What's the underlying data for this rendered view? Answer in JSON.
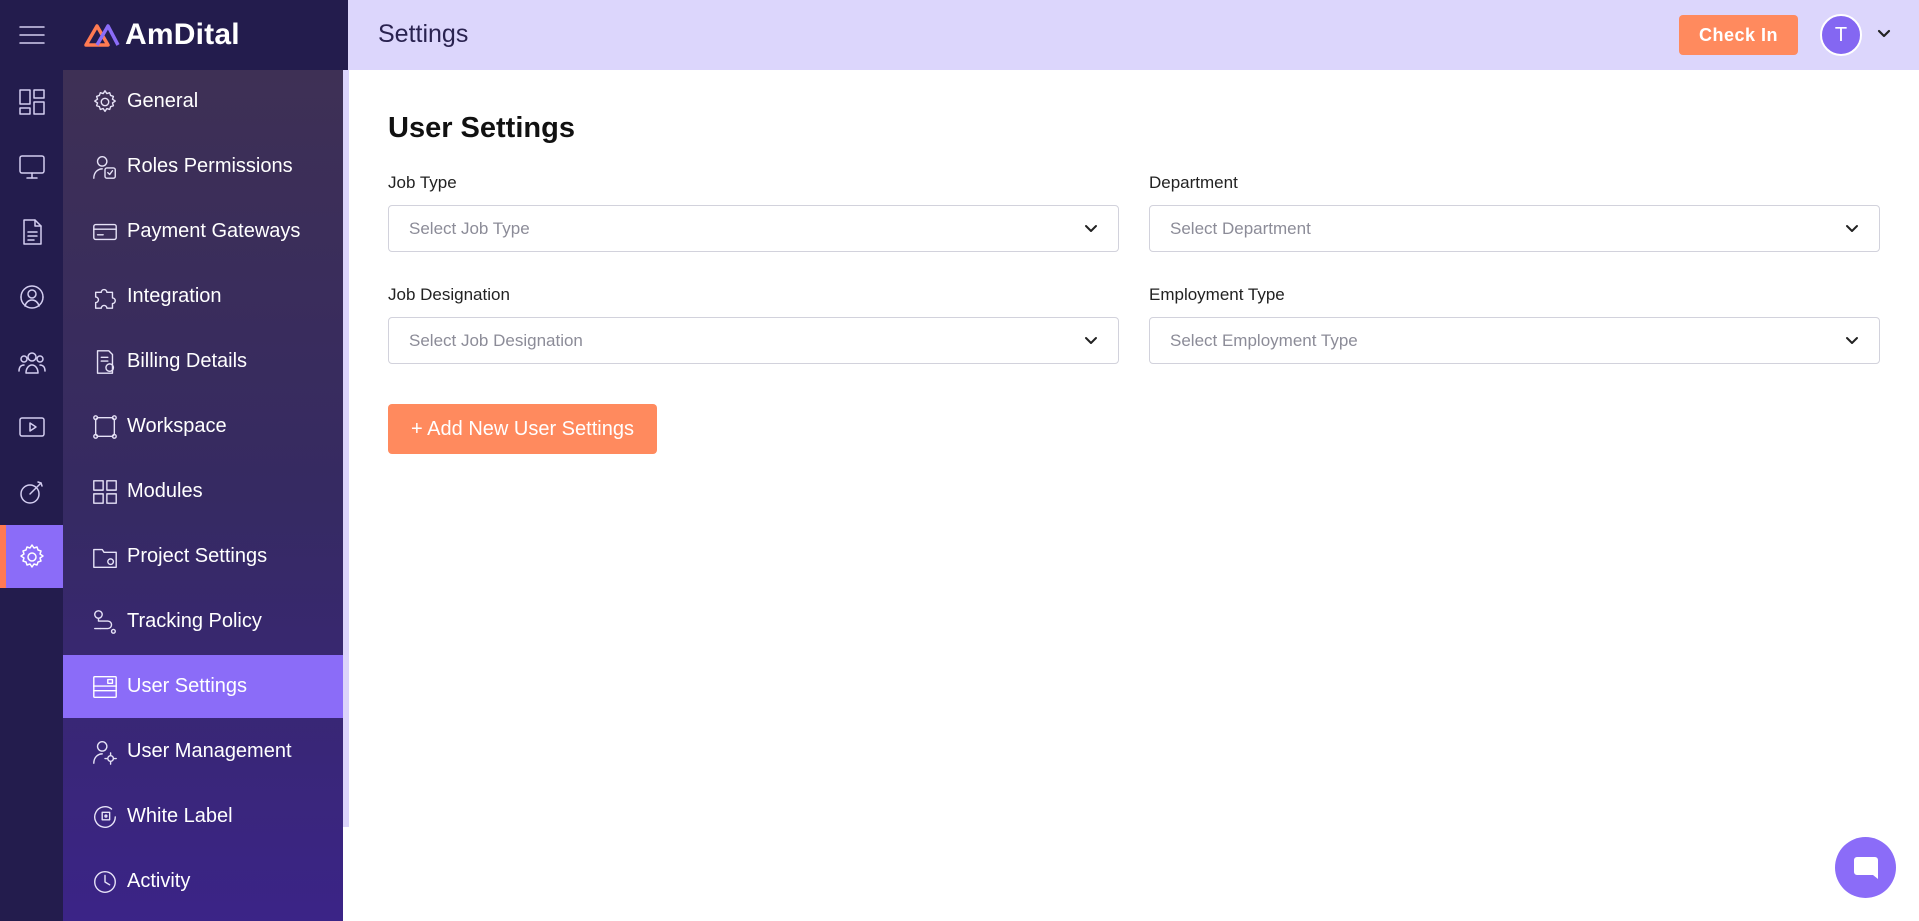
{
  "brand": {
    "name": "AmDital"
  },
  "header": {
    "title": "Settings",
    "checkin_label": "Check In",
    "avatar_initial": "T"
  },
  "rail": {
    "items": [
      {
        "name": "menu-icon"
      },
      {
        "name": "dashboard-icon"
      },
      {
        "name": "monitor-icon"
      },
      {
        "name": "document-icon"
      },
      {
        "name": "team-orbit-icon"
      },
      {
        "name": "users-icon"
      },
      {
        "name": "video-icon"
      },
      {
        "name": "goal-icon"
      },
      {
        "name": "gear-icon",
        "active": true
      }
    ]
  },
  "settings_menu": {
    "items": [
      {
        "label": "General",
        "icon": "gear-icon"
      },
      {
        "label": "Roles Permissions",
        "icon": "roles-icon"
      },
      {
        "label": "Payment Gateways",
        "icon": "card-icon"
      },
      {
        "label": "Integration",
        "icon": "puzzle-icon"
      },
      {
        "label": "Billing Details",
        "icon": "billing-icon"
      },
      {
        "label": "Workspace",
        "icon": "workspace-icon"
      },
      {
        "label": "Modules",
        "icon": "grid-icon"
      },
      {
        "label": "Project Settings",
        "icon": "folder-settings-icon"
      },
      {
        "label": "Tracking Policy",
        "icon": "route-icon"
      },
      {
        "label": "User Settings",
        "icon": "window-icon",
        "active": true
      },
      {
        "label": "User Management",
        "icon": "user-gear-icon"
      },
      {
        "label": "White Label",
        "icon": "tag-icon"
      },
      {
        "label": "Activity",
        "icon": "clock-icon"
      }
    ]
  },
  "main": {
    "title": "User Settings",
    "fields": {
      "job_type": {
        "label": "Job Type",
        "placeholder": "Select Job Type"
      },
      "department": {
        "label": "Department",
        "placeholder": "Select Department"
      },
      "job_designation": {
        "label": "Job Designation",
        "placeholder": "Select Job Designation"
      },
      "employment_type": {
        "label": "Employment Type",
        "placeholder": "Select Employment Type"
      }
    },
    "add_button_label": "+ Add New User Settings"
  },
  "colors": {
    "accent": "#8b6cf8",
    "brand_orange": "#ff8a5e",
    "sidebar_dark": "#231c4d",
    "header_bg": "#dcd6fc"
  }
}
